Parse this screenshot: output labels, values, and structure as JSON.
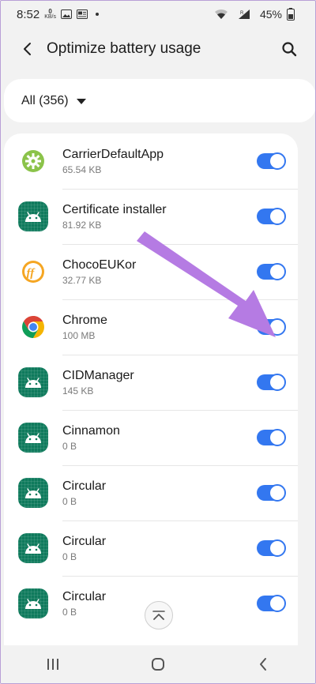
{
  "status_bar": {
    "time": "8:52",
    "net_speed_value": "0",
    "net_speed_unit": "KB/s",
    "battery_percent": "45%"
  },
  "header": {
    "title": "Optimize battery usage"
  },
  "filter": {
    "label": "All (356)"
  },
  "apps": [
    {
      "name": "CarrierDefaultApp",
      "size": "65.54 KB",
      "icon": "carrier-gear-icon",
      "enabled": true
    },
    {
      "name": "Certificate installer",
      "size": "81.92 KB",
      "icon": "android-icon",
      "enabled": true
    },
    {
      "name": "ChocoEUKor",
      "size": "32.77 KB",
      "icon": "choco-font-icon",
      "enabled": true
    },
    {
      "name": "Chrome",
      "size": "100 MB",
      "icon": "chrome-icon",
      "enabled": true
    },
    {
      "name": "CIDManager",
      "size": "145 KB",
      "icon": "android-icon",
      "enabled": true
    },
    {
      "name": "Cinnamon",
      "size": "0 B",
      "icon": "android-icon",
      "enabled": true
    },
    {
      "name": "Circular",
      "size": "0 B",
      "icon": "android-icon",
      "enabled": true
    },
    {
      "name": "Circular",
      "size": "0 B",
      "icon": "android-icon",
      "enabled": true
    },
    {
      "name": "Circular",
      "size": "0 B",
      "icon": "android-icon",
      "enabled": true
    }
  ],
  "colors": {
    "toggle_on": "#3377f0",
    "android_icon_bg": "#0f7a5c",
    "annotation_arrow": "#b57be3"
  }
}
